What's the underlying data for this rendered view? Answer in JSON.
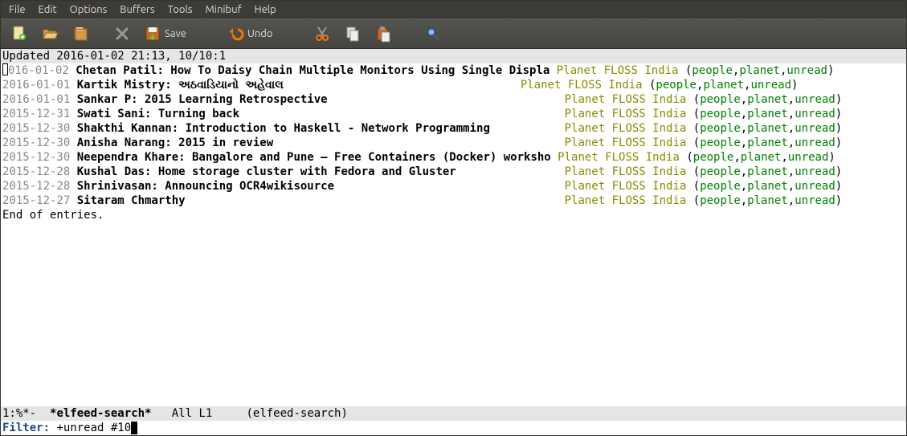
{
  "menubar": {
    "items": [
      "File",
      "Edit",
      "Options",
      "Buffers",
      "Tools",
      "Minibuf",
      "Help"
    ]
  },
  "toolbar": {
    "save_label": "Save",
    "undo_label": "Undo"
  },
  "header": {
    "text": "Updated 2016-01-02 21:13, 10/10:1"
  },
  "feed_label": "Planet FLOSS India",
  "tag_open": "(",
  "tag_close": ")",
  "tag_sep": ",",
  "tags": [
    "people",
    "planet",
    "unread"
  ],
  "entries": [
    {
      "date": "2016-01-02",
      "title": "Chetan Patil: How To Daisy Chain Multiple Monitors Using Single Displa",
      "pad": " "
    },
    {
      "date": "2016-01-01",
      "title": "Kartik Mistry: અઠવાડિયાનો અહેવાલ",
      "pad": "                                   "
    },
    {
      "date": "2016-01-01",
      "title": "Sankar P: 2015 Learning Retrospective",
      "pad": "                                   "
    },
    {
      "date": "2015-12-31",
      "title": "Swati Sani: Turning back",
      "pad": "                                                "
    },
    {
      "date": "2015-12-30",
      "title": "Shakthi Kannan: Introduction to Haskell - Network Programming",
      "pad": "           "
    },
    {
      "date": "2015-12-30",
      "title": "Anisha Narang: 2015 in review",
      "pad": "                                           "
    },
    {
      "date": "2015-12-30",
      "title": "Neependra Khare: Bangalore and Pune – Free Containers (Docker) worksho",
      "pad": " "
    },
    {
      "date": "2015-12-28",
      "title": "Kushal Das: Home storage cluster with Fedora and Gluster",
      "pad": "                "
    },
    {
      "date": "2015-12-28",
      "title": "Shrinivasan: Announcing OCR4wikisource",
      "pad": "                                  "
    },
    {
      "date": "2015-12-27",
      "title": "Sitaram Chmarthy",
      "pad": "                                                        "
    }
  ],
  "end_text": "End of entries.",
  "modeline": {
    "left": "1:%*-  ",
    "buffer": "*elfeed-search*",
    "mid": "   All L1     ",
    "mode": "(elfeed-search)"
  },
  "minibuffer": {
    "label": "Filter: ",
    "value": "+unread #10"
  }
}
